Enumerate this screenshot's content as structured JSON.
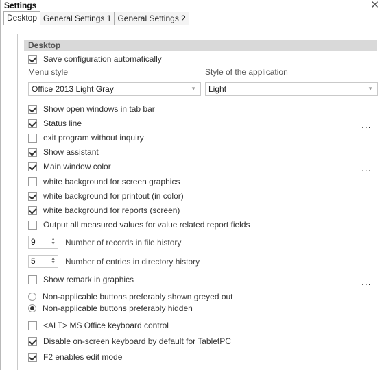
{
  "window": {
    "title": "Settings",
    "close_icon": "close-icon"
  },
  "tabs": [
    {
      "label": "Desktop",
      "active": true
    },
    {
      "label": "General Settings 1",
      "active": false
    },
    {
      "label": "General Settings 2",
      "active": false
    }
  ],
  "group": {
    "header": "Desktop"
  },
  "save_config": {
    "label": "Save configuration automatically",
    "checked": true
  },
  "menu_style": {
    "label": "Menu style",
    "value": "Office 2013 Light Gray"
  },
  "app_style": {
    "label": "Style of the application",
    "value": "Light"
  },
  "options": [
    {
      "label": "Show open windows in tab bar",
      "checked": true
    },
    {
      "label": "Status line",
      "checked": true
    },
    {
      "label": "exit program without inquiry",
      "checked": false
    },
    {
      "label": "Show assistant",
      "checked": true
    },
    {
      "label": "Main window color",
      "checked": true
    },
    {
      "label": "white background for screen graphics",
      "checked": false
    },
    {
      "label": "white background for printout (in color)",
      "checked": true
    },
    {
      "label": "white background for reports (screen)",
      "checked": true
    },
    {
      "label": "Output all measured values for value related report fields",
      "checked": false
    }
  ],
  "file_history": {
    "value": "9",
    "label": "Number of records in file history"
  },
  "dir_history": {
    "value": "5",
    "label": "Number of entries in directory history"
  },
  "show_remark": {
    "label": "Show remark in graphics",
    "checked": false
  },
  "button_mode": [
    {
      "label": "Non-applicable buttons preferably shown greyed out",
      "selected": false
    },
    {
      "label": "Non-applicable buttons preferably hidden",
      "selected": true
    }
  ],
  "lower_options": [
    {
      "label": "<ALT> MS Office keyboard control",
      "checked": false
    },
    {
      "label": "Disable on-screen keyboard by default for TabletPC",
      "checked": true
    },
    {
      "label": "F2 enables edit mode",
      "checked": true
    }
  ],
  "ellipsis": "..."
}
